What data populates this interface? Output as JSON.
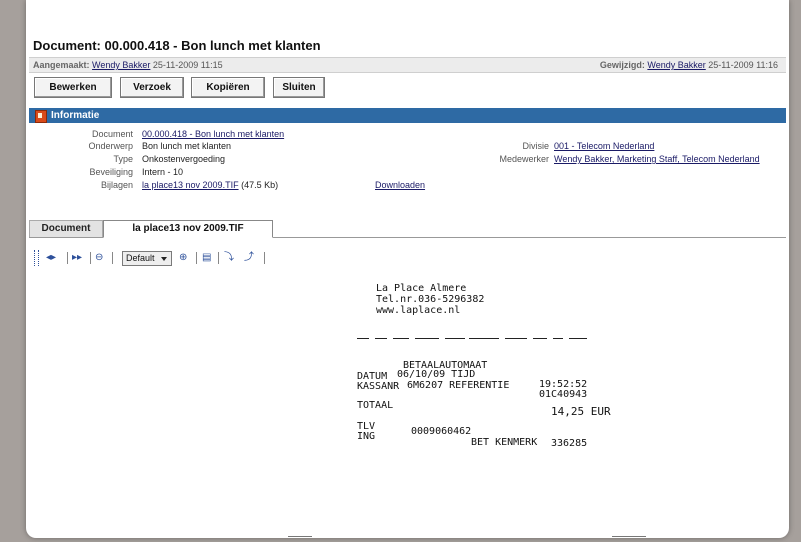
{
  "document": {
    "title": "Document: 00.000.418 - Bon lunch met klanten",
    "created_label": "Aangemaakt:",
    "created_by": "Wendy Bakker",
    "created_at": "25-11-2009 11:15",
    "modified_label": "Gewijzigd:",
    "modified_by": "Wendy Bakker",
    "modified_at": "25-11-2009 11:16"
  },
  "toolbar_buttons": {
    "edit": "Bewerken",
    "request": "Verzoek",
    "copy": "Kopiëren",
    "close": "Sluiten"
  },
  "info": {
    "header": "Informatie",
    "document_label": "Document",
    "document_value": "00.000.418 - Bon lunch met klanten",
    "subject_label": "Onderwerp",
    "subject_value": "Bon lunch met klanten",
    "type_label": "Type",
    "type_value": "Onkostenvergoeding",
    "security_label": "Beveiliging",
    "security_value": "Intern - 10",
    "attachments_label": "Bijlagen",
    "attachment_file": "la place13 nov 2009.TIF",
    "attachment_size": "(47.5 Kb)",
    "download": "Downloaden",
    "division_label": "Divisie",
    "division_value": "001 - Telecom Nederland",
    "employee_label": "Medewerker",
    "employee_value": "Wendy Bakker, Marketing Staff, Telecom Nederland"
  },
  "tabs": {
    "document": "Document",
    "attachment": "la place13 nov 2009.TIF"
  },
  "viewer": {
    "zoom_select": "Default"
  },
  "receipt": {
    "line1": "La Place Almere",
    "line2": "Tel.nr.036-5296382",
    "line3": "www.laplace.nl",
    "header": "BETAALAUTOMAAT",
    "datum_label": "DATUM",
    "datum_value": "06/10/09 TIJD",
    "time": "19:52:52",
    "kassa_label": "KASSANR",
    "kassa_value": "6M6207 REFERENTIE",
    "ref": "01C40943",
    "totaal_label": "TOTAAL",
    "amount": "14,25 EUR",
    "tlv_label": "TLV",
    "tlv_value": "0009060462",
    "ing_label": "ING",
    "kenmerk": "BET KENMERK",
    "kenmerk_value": "336285"
  }
}
